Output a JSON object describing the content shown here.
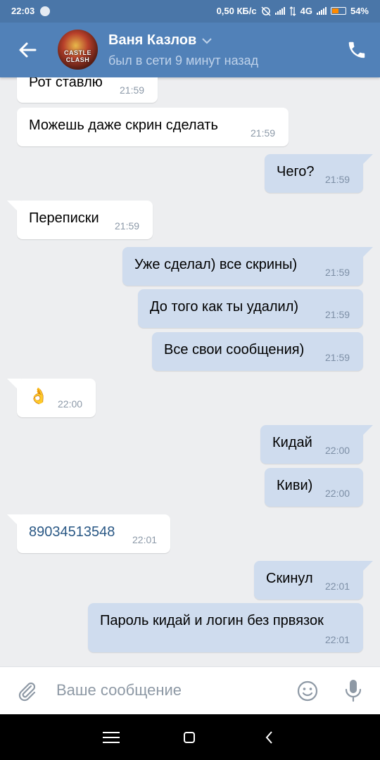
{
  "status_bar": {
    "time": "22:03",
    "speed": "0,50 КБ/с",
    "network": "4G",
    "battery": "54%",
    "battery_level": 0.54
  },
  "header": {
    "contact_name": "Ваня Казлов",
    "contact_status": "был в сети 9 минут назад",
    "avatar_text": "CASTLE CLASH",
    "back_icon": "arrow-left-icon",
    "call_icon": "phone-icon"
  },
  "messages": [
    {
      "dir": "in",
      "text": "Рот ставлю",
      "time": "21:59"
    },
    {
      "dir": "in",
      "text": "Можешь даже скрин сделать",
      "time": "21:59"
    },
    {
      "dir": "out",
      "text": "Чего?",
      "time": "21:59"
    },
    {
      "dir": "in",
      "text": "Переписки",
      "time": "21:59"
    },
    {
      "dir": "out",
      "text": "Уже сделал) все скрины)",
      "time": "21:59"
    },
    {
      "dir": "out",
      "text": "До того как ты удалил)",
      "time": "21:59"
    },
    {
      "dir": "out",
      "text": "Все свои сообщения)",
      "time": "21:59"
    },
    {
      "dir": "in",
      "text": "👌",
      "time": "22:00"
    },
    {
      "dir": "out",
      "text": "Кидай",
      "time": "22:00"
    },
    {
      "dir": "out",
      "text": "Киви)",
      "time": "22:00"
    },
    {
      "dir": "in",
      "text": "89034513548",
      "time": "22:01"
    },
    {
      "dir": "out",
      "text": "Скинул",
      "time": "22:01"
    },
    {
      "dir": "out",
      "text": "Пароль кидай и логин без првязок",
      "time": "22:01"
    }
  ],
  "composer": {
    "placeholder": "Ваше сообщение",
    "attach_icon": "paperclip-icon",
    "emoji_icon": "smile-icon",
    "voice_icon": "microphone-icon"
  },
  "nav_bar": {
    "menu_icon": "menu-icon",
    "home_icon": "home-square-icon",
    "back_icon": "nav-back-icon"
  },
  "colors": {
    "header": "#5181b8",
    "status_bar": "#4a76a8",
    "chat_bg": "#edeef0",
    "incoming_bubble": "#ffffff",
    "outgoing_bubble": "#cfdcee",
    "link": "#2a5885"
  }
}
